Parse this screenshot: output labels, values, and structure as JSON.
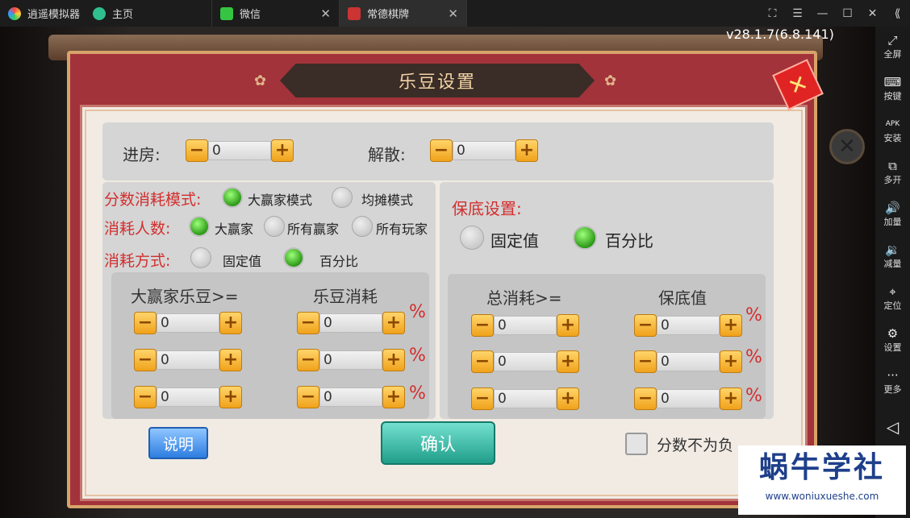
{
  "topbar": {
    "app_name": "逍遥模拟器",
    "tabs": [
      {
        "label": "主页"
      },
      {
        "label": "微信"
      },
      {
        "label": "常德棋牌"
      }
    ],
    "window_controls": [
      "⛶",
      "☰",
      "—",
      "☐",
      "✕",
      "⟪"
    ]
  },
  "sidebar": {
    "items": [
      {
        "label": "全屏",
        "glyph": "⤢"
      },
      {
        "label": "按键",
        "glyph": "⌨"
      },
      {
        "label": "安装",
        "glyph": "APK"
      },
      {
        "label": "多开",
        "glyph": "⧉"
      },
      {
        "label": "加量",
        "glyph": "🔊"
      },
      {
        "label": "减量",
        "glyph": "🔉"
      },
      {
        "label": "定位",
        "glyph": "⌖"
      },
      {
        "label": "设置",
        "glyph": "⚙"
      },
      {
        "label": "更多",
        "glyph": "···"
      },
      {
        "label": "",
        "glyph": "◁"
      }
    ]
  },
  "game": {
    "version": "v28.1.7(6.8.141)",
    "dialog_title": "乐豆设置",
    "close_glyph": "✕",
    "tag_glyph": "✕",
    "entry": {
      "label": "进房:",
      "value": "0"
    },
    "dissolve": {
      "label": "解散:",
      "value": "0"
    },
    "score_mode": {
      "label": "分数消耗模式:",
      "options": [
        "大赢家模式",
        "均摊模式"
      ],
      "selected": 0
    },
    "consumers": {
      "label": "消耗人数:",
      "options": [
        "大赢家",
        "所有赢家",
        "所有玩家"
      ],
      "selected": 0
    },
    "consume_way": {
      "label": "消耗方式:",
      "options": [
        "固定值",
        "百分比"
      ],
      "selected": 1
    },
    "left_table": {
      "col1": "大赢家乐豆>=",
      "col2": "乐豆消耗",
      "rows": [
        [
          "0",
          "0"
        ],
        [
          "0",
          "0"
        ],
        [
          "0",
          "0"
        ]
      ],
      "unit": "%"
    },
    "guarantee": {
      "label": "保底设置:",
      "options": [
        "固定值",
        "百分比"
      ],
      "selected": 1
    },
    "right_table": {
      "col1": "总消耗>=",
      "col2": "保底值",
      "rows": [
        [
          "0",
          "0"
        ],
        [
          "0",
          "0"
        ],
        [
          "0",
          "0"
        ]
      ],
      "unit": "%"
    },
    "minus": "−",
    "plus": "+",
    "info_button": "说明",
    "confirm_button": "确认",
    "nonneg_label": "分数不为负"
  },
  "watermark": {
    "title": "蜗牛学社",
    "url": "www.woniuxueshe.com"
  },
  "colors": {
    "accent_red": "#d32e2e",
    "frame": "#a2333a",
    "confirm": "#1f9e8a"
  }
}
